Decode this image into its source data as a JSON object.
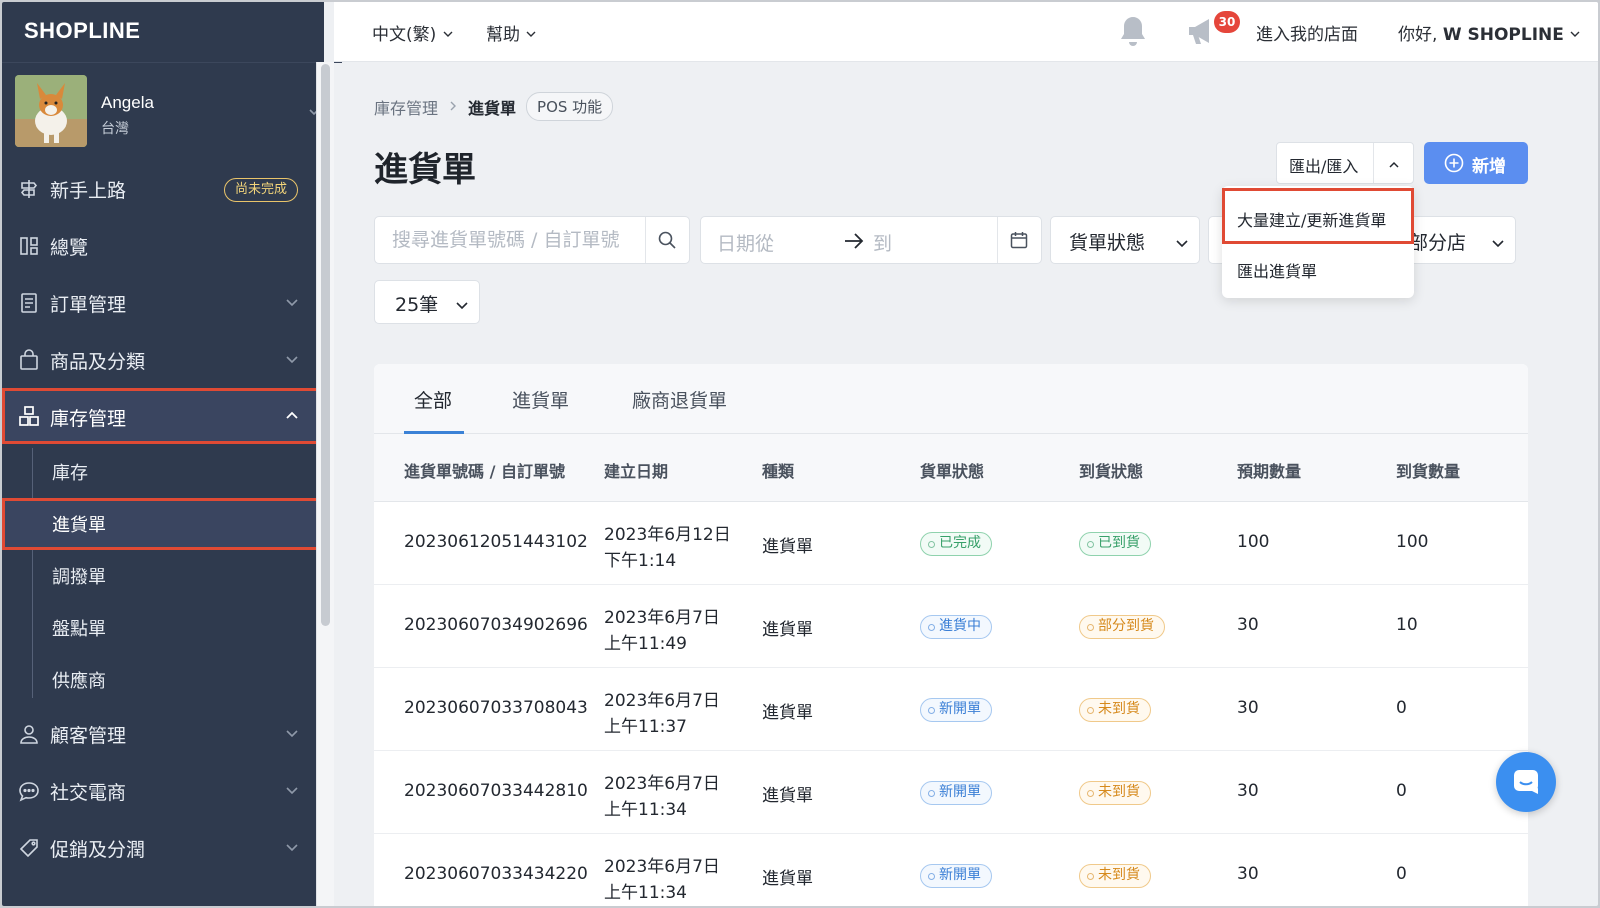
{
  "brand": {
    "logo": "SHOPLINE"
  },
  "profile": {
    "name": "Angela",
    "location": "台灣"
  },
  "sidebar": {
    "items": [
      {
        "label": "新手上路",
        "icon": "signpost-icon",
        "badge": "尚未完成"
      },
      {
        "label": "總覽",
        "icon": "dashboard-icon"
      },
      {
        "label": "訂單管理",
        "icon": "orders-icon"
      },
      {
        "label": "商品及分類",
        "icon": "shopping-bag-icon"
      },
      {
        "label": "庫存管理",
        "icon": "inventory-icon"
      },
      {
        "label": "顧客管理",
        "icon": "person-icon"
      },
      {
        "label": "社交電商",
        "icon": "chat-bubble-icon"
      },
      {
        "label": "促銷及分潤",
        "icon": "tag-icon"
      }
    ],
    "inventory_sub": [
      "庫存",
      "進貨單",
      "調撥單",
      "盤點單",
      "供應商"
    ]
  },
  "topbar": {
    "language": "中文(繁)",
    "help": "幫助",
    "notification_count": "30",
    "store_link": "進入我的店面",
    "greeting_prefix": "你好, ",
    "greeting_name": "W SHOPLINE"
  },
  "breadcrumb": {
    "parent": "庫存管理",
    "current": "進貨單",
    "pill": "POS 功能"
  },
  "page": {
    "title": "進貨單"
  },
  "actions": {
    "export_import": "匯出/匯入",
    "new": "新增",
    "dropdown": [
      "大量建立/更新進貨單",
      "匯出進貨單"
    ]
  },
  "filters": {
    "search_placeholder": "搜尋進貨單號碼 / 自訂單號",
    "date_from": "日期從",
    "date_to": "到",
    "status": "貨單狀態",
    "store": "部分店",
    "per_page": "25筆"
  },
  "tabs": [
    "全部",
    "進貨單",
    "廠商退貨單"
  ],
  "table": {
    "headers": [
      "進貨單號碼 / 自訂單號",
      "建立日期",
      "種類",
      "貨單狀態",
      "到貨狀態",
      "預期數量",
      "到貨數量"
    ],
    "rows": [
      {
        "id": "20230612051443102",
        "date": "2023年6月12日",
        "time": "下午1:14",
        "type": "進貨單",
        "status": "已完成",
        "status_tone": "green",
        "arrival": "已到貨",
        "arrival_tone": "green",
        "expected": "100",
        "received": "100"
      },
      {
        "id": "20230607034902696",
        "date": "2023年6月7日",
        "time": "上午11:49",
        "type": "進貨單",
        "status": "進貨中",
        "status_tone": "blue",
        "arrival": "部分到貨",
        "arrival_tone": "orange",
        "expected": "30",
        "received": "10"
      },
      {
        "id": "20230607033708043",
        "date": "2023年6月7日",
        "time": "上午11:37",
        "type": "進貨單",
        "status": "新開單",
        "status_tone": "blue",
        "arrival": "未到貨",
        "arrival_tone": "orange",
        "expected": "30",
        "received": "0"
      },
      {
        "id": "20230607033442810",
        "date": "2023年6月7日",
        "time": "上午11:34",
        "type": "進貨單",
        "status": "新開單",
        "status_tone": "blue",
        "arrival": "未到貨",
        "arrival_tone": "orange",
        "expected": "30",
        "received": "0"
      },
      {
        "id": "20230607033434220",
        "date": "2023年6月7日",
        "time": "上午11:34",
        "type": "進貨單",
        "status": "新開單",
        "status_tone": "blue",
        "arrival": "未到貨",
        "arrival_tone": "orange",
        "expected": "30",
        "received": "0"
      }
    ]
  },
  "colors": {
    "sidebar_bg": "#2f3a4e",
    "accent_blue": "#5b8ef0",
    "highlight_red": "#e04a34"
  }
}
